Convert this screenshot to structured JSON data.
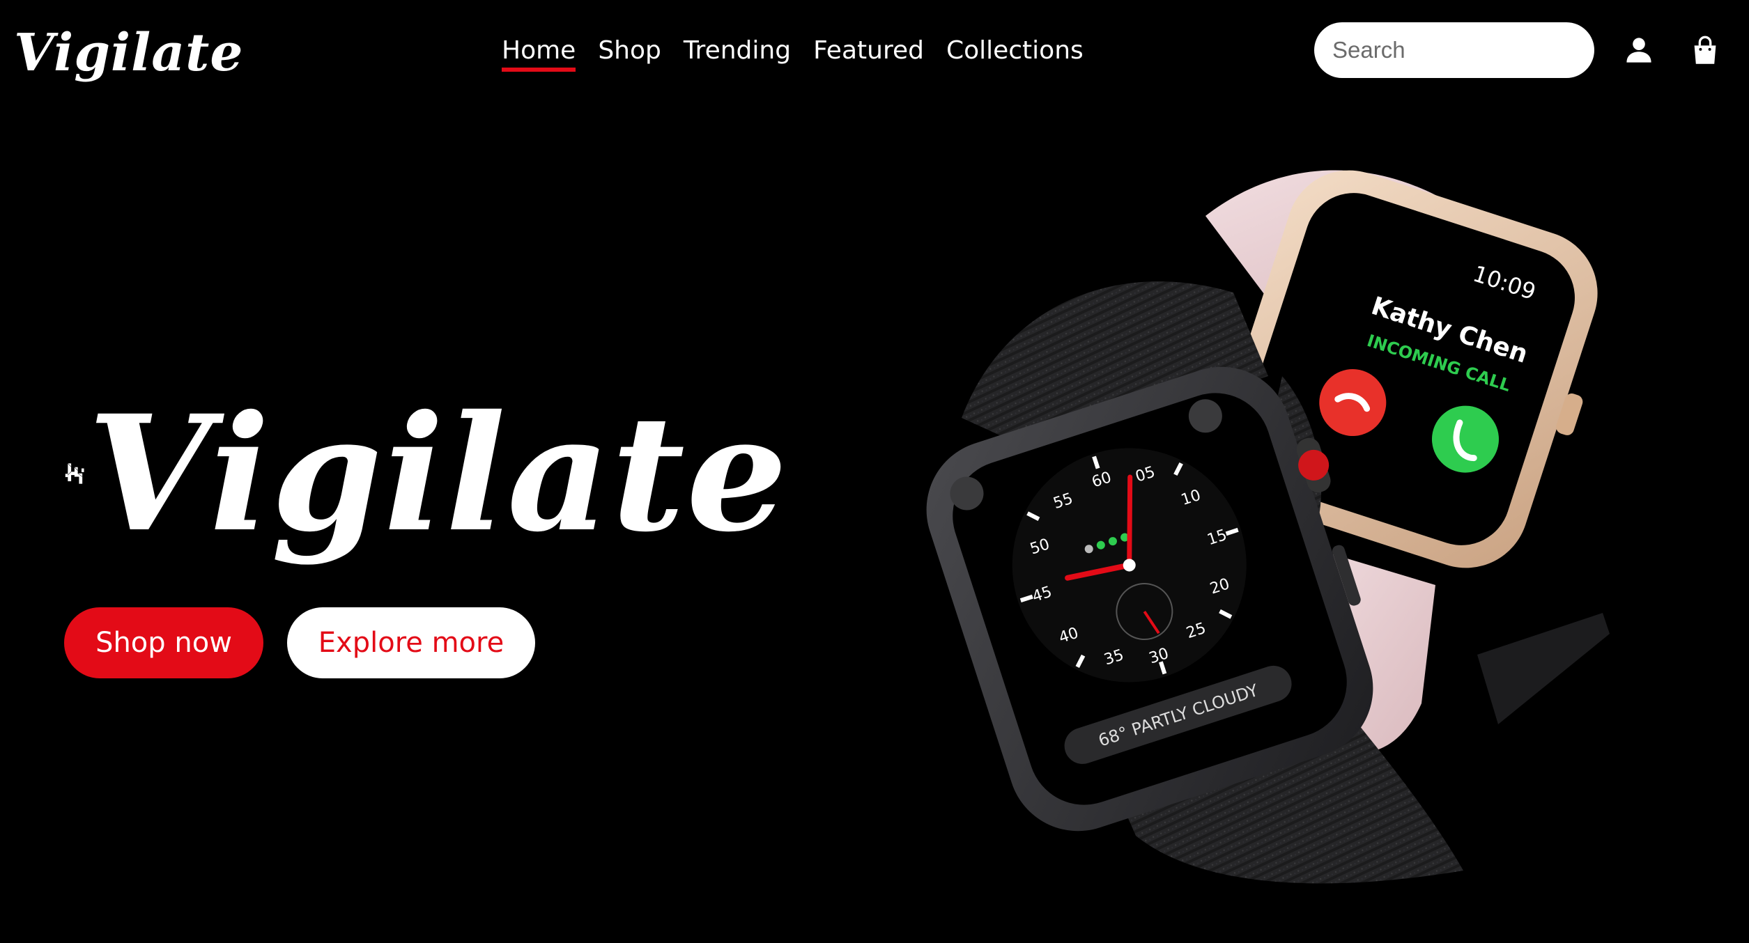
{
  "brand": {
    "name": "Vigilate",
    "logo_icon": "hh-monogram-icon"
  },
  "nav": {
    "items": [
      {
        "label": "Home",
        "active": true
      },
      {
        "label": "Shop",
        "active": false
      },
      {
        "label": "Trending",
        "active": false
      },
      {
        "label": "Featured",
        "active": false
      },
      {
        "label": "Collections",
        "active": false
      }
    ]
  },
  "search": {
    "placeholder": "Search",
    "value": ""
  },
  "header_icons": {
    "account": "user-icon",
    "cart": "shopping-bag-icon"
  },
  "hero": {
    "title": "Vigilate",
    "primary_cta": "Shop now",
    "secondary_cta": "Explore more"
  },
  "watch_front": {
    "dial_numbers": [
      "05",
      "10",
      "15",
      "20",
      "25",
      "30",
      "35",
      "40",
      "45",
      "50",
      "55",
      "60"
    ],
    "complication": "68° PARTLY CLOUDY"
  },
  "watch_back": {
    "time": "10:09",
    "caller": "Kathy Chen",
    "status": "INCOMING CALL"
  },
  "colors": {
    "accent": "#e30b17",
    "background": "#000000",
    "text": "#ffffff",
    "call_accept": "#2ecc4f",
    "call_decline": "#e8312a",
    "band_pink": "#e9cfd2",
    "case_gold": "#e7c4a4"
  }
}
